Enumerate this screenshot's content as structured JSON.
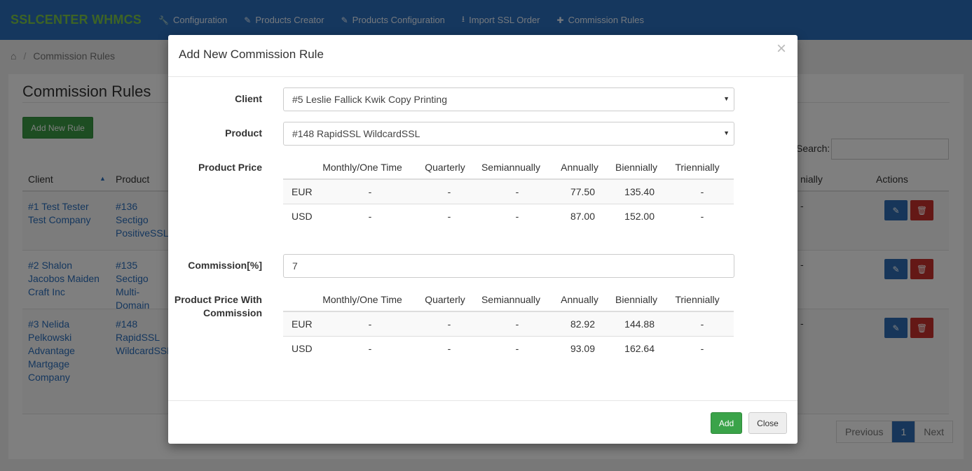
{
  "nav": {
    "brand": "SSLCENTER WHMCS",
    "items": [
      {
        "label": "Configuration",
        "icon": "wrench-icon",
        "glyph": "🔧"
      },
      {
        "label": "Products Creator",
        "icon": "magic-wand-icon",
        "glyph": "✎"
      },
      {
        "label": "Products Configuration",
        "icon": "edit-icon",
        "glyph": "✎"
      },
      {
        "label": "Import SSL Order",
        "icon": "download-icon",
        "glyph": "⭳"
      },
      {
        "label": "Commission Rules",
        "icon": "user-plus-icon",
        "glyph": "✚"
      }
    ]
  },
  "breadcrumb": {
    "home_icon": "home-icon",
    "separator": "/",
    "current": "Commission Rules"
  },
  "page": {
    "title": "Commission Rules",
    "add_rule_button": "Add New Rule",
    "search_label": "Search:",
    "search_value": "",
    "table": {
      "columns": [
        "Client",
        "Product",
        "nially",
        "Actions"
      ],
      "rows": [
        {
          "client": "#1 Test Tester Test Company",
          "product": "#136 Sectigo PositiveSSL",
          "value": "-"
        },
        {
          "client": "#2 Shalon Jacobos Maiden Craft Inc",
          "product": "#135 Sectigo Multi-Domain",
          "value": "-"
        },
        {
          "client": "#3 Nelida Pelkowski Advantage Martgage Company",
          "product": "#148 RapidSSL WildcardSSL",
          "value": "-"
        }
      ]
    },
    "pagination": {
      "previous": "Previous",
      "current": "1",
      "next": "Next"
    }
  },
  "modal": {
    "title": "Add New Commission Rule",
    "close_glyph": "×",
    "client_label": "Client",
    "client_value": "#5 Leslie Fallick Kwik Copy Printing",
    "product_label": "Product",
    "product_value": "#148 RapidSSL WildcardSSL",
    "price_label": "Product Price",
    "commission_label": "Commission[%]",
    "commission_value": "7",
    "price_with_commission_label": "Product Price With Commission",
    "cycles": [
      "Monthly/One Time",
      "Quarterly",
      "Semiannually",
      "Annually",
      "Biennially",
      "Triennially"
    ],
    "prices": [
      {
        "currency": "EUR",
        "values": [
          "-",
          "-",
          "-",
          "77.50",
          "135.40",
          "-"
        ]
      },
      {
        "currency": "USD",
        "values": [
          "-",
          "-",
          "-",
          "87.00",
          "152.00",
          "-"
        ]
      }
    ],
    "prices_with_commission": [
      {
        "currency": "EUR",
        "values": [
          "-",
          "-",
          "-",
          "82.92",
          "144.88",
          "-"
        ]
      },
      {
        "currency": "USD",
        "values": [
          "-",
          "-",
          "-",
          "93.09",
          "162.64",
          "-"
        ]
      }
    ],
    "add_button": "Add",
    "close_button": "Close"
  }
}
